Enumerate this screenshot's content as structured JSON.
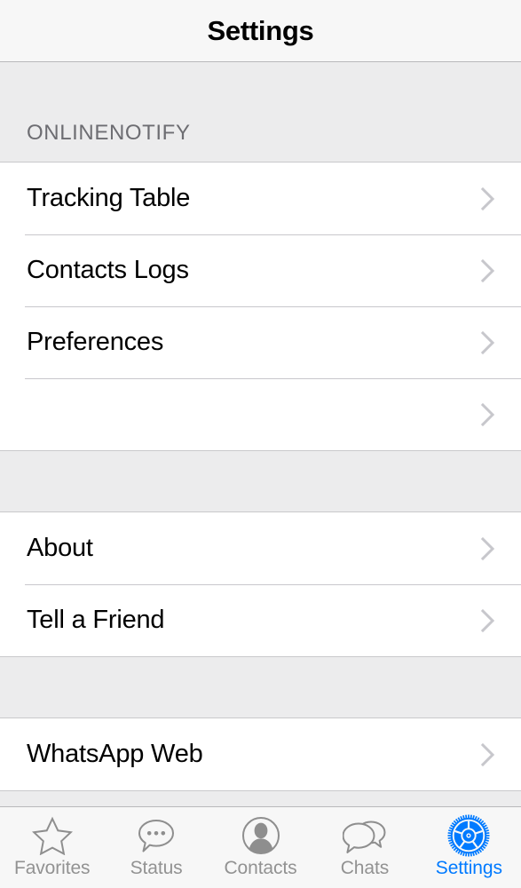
{
  "navbar": {
    "title": "Settings"
  },
  "colors": {
    "accent": "#007aff",
    "navbar_bg": "#f7f7f7",
    "group_bg": "#ececed",
    "row_bg": "#ffffff",
    "separator": "#c8c7cc",
    "label": "#000000",
    "muted_label": "#6d6d72",
    "tab_inactive": "#929292"
  },
  "sections": [
    {
      "header": "ONLINENOTIFY",
      "rows": [
        {
          "label": "Tracking Table",
          "accessory": "chevron-right-icon"
        },
        {
          "label": "Contacts Logs",
          "accessory": "chevron-right-icon"
        },
        {
          "label": "Preferences",
          "accessory": "chevron-right-icon"
        },
        {
          "label": "",
          "accessory": "chevron-right-icon"
        }
      ]
    },
    {
      "header": "",
      "rows": [
        {
          "label": "About",
          "accessory": "chevron-right-icon"
        },
        {
          "label": "Tell a Friend",
          "accessory": "chevron-right-icon"
        }
      ]
    },
    {
      "header": "",
      "rows": [
        {
          "label": "WhatsApp Web",
          "accessory": "chevron-right-icon"
        }
      ]
    }
  ],
  "tabbar": {
    "active_index": 4,
    "items": [
      {
        "label": "Favorites",
        "icon": "star-outline-icon"
      },
      {
        "label": "Status",
        "icon": "speech-bubble-ellipsis-icon"
      },
      {
        "label": "Contacts",
        "icon": "person-circle-icon"
      },
      {
        "label": "Chats",
        "icon": "double-speech-bubble-icon"
      },
      {
        "label": "Settings",
        "icon": "gear-icon"
      }
    ]
  }
}
